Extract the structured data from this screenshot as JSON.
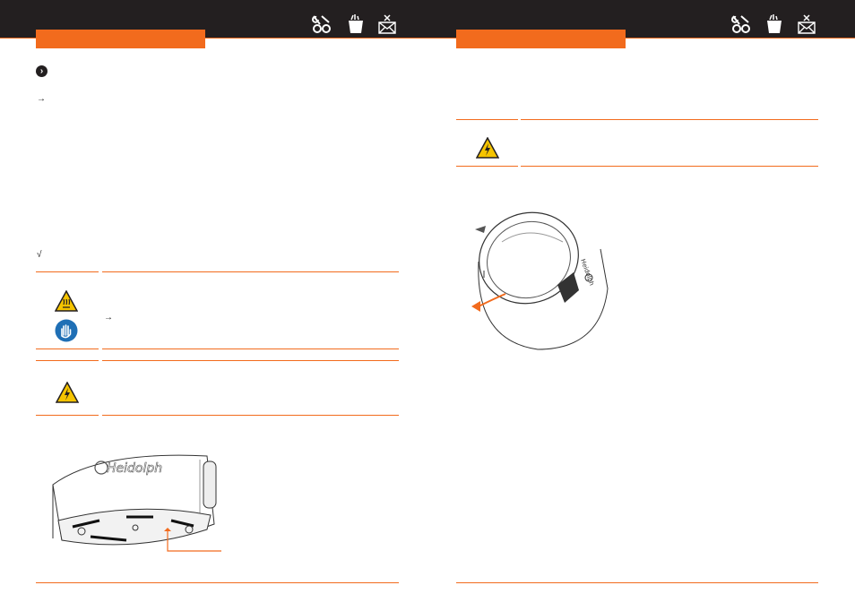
{
  "header": {
    "icons": [
      "wrench-screwdriver-icon",
      "bucket-icon",
      "envelope-tools-icon"
    ]
  },
  "left_page": {
    "bullet_icon": "chevron-right-circle-icon",
    "arrow_glyph": "→",
    "check_glyph": "√",
    "warning_box_1": {
      "icons": [
        "hot-surface-warning-icon",
        "wear-gloves-icon"
      ],
      "arrow_glyph": "→"
    },
    "warning_box_2": {
      "icons": [
        "electrical-hazard-icon"
      ]
    },
    "figure": {
      "brand": "Heidolph"
    }
  },
  "right_page": {
    "warning_box": {
      "icons": [
        "electrical-hazard-icon"
      ]
    },
    "figure": {
      "brand": "Heidolph"
    }
  },
  "colors": {
    "accent": "#f26b1d",
    "bar": "#231f20",
    "warning_yellow": "#f5c400",
    "mandatory_blue": "#1f6fb5"
  }
}
